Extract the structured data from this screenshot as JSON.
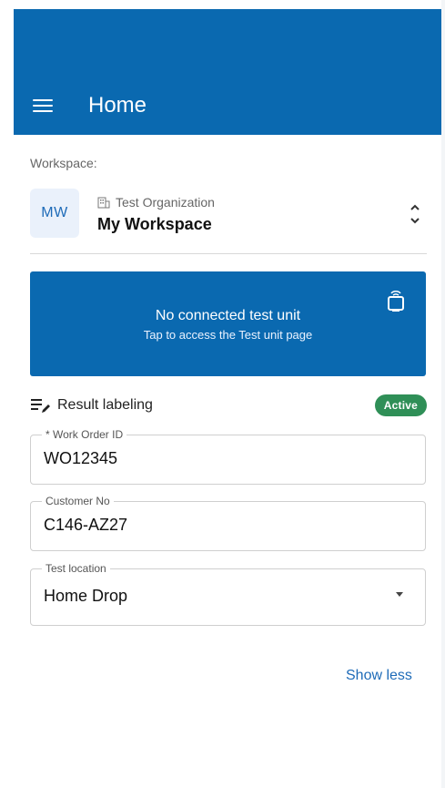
{
  "header": {
    "title": "Home",
    "menu_icon": "hamburger-menu-icon"
  },
  "workspace": {
    "label": "Workspace:",
    "avatar_initials": "MW",
    "organization": "Test Organization",
    "name": "My Workspace"
  },
  "test_unit_card": {
    "title": "No connected test unit",
    "subtitle": "Tap to access the Test unit page"
  },
  "result_labeling": {
    "label": "Result labeling",
    "status": "Active"
  },
  "fields": {
    "work_order": {
      "label": "* Work Order ID",
      "value": "WO12345"
    },
    "customer": {
      "label": "Customer No",
      "value": "C146-AZ27"
    },
    "location": {
      "label": "Test location",
      "value": "Home Drop"
    }
  },
  "actions": {
    "show_less": "Show less"
  },
  "colors": {
    "primary": "#0A69B0",
    "active_badge": "#2F8F57",
    "link": "#1E6BB8"
  }
}
